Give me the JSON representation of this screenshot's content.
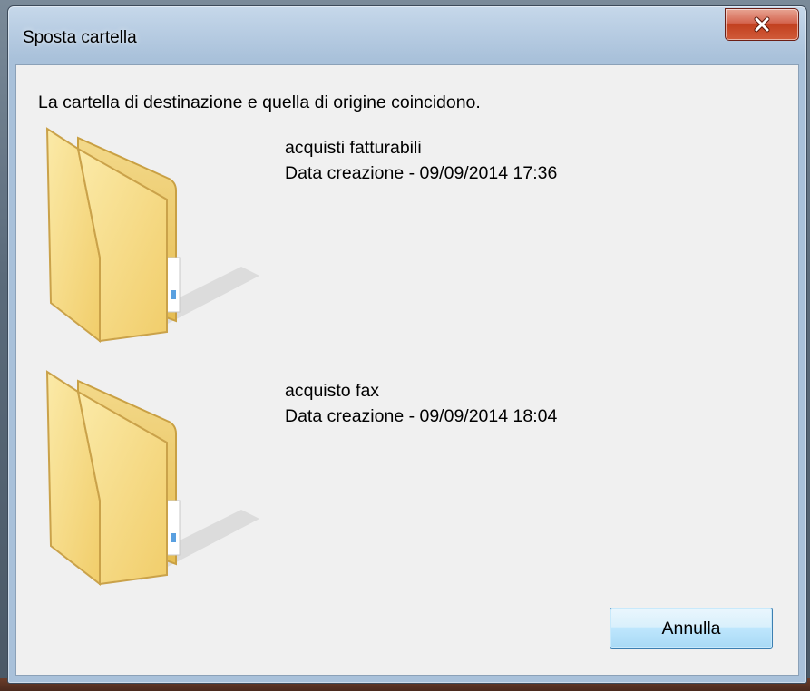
{
  "window": {
    "title": "Sposta cartella",
    "close_icon": "close-icon"
  },
  "message": "La cartella di destinazione e quella di origine coincidono.",
  "items": [
    {
      "name": "acquisti fatturabili",
      "date": "Data creazione - 09/09/2014 17:36",
      "icon": "folder-icon"
    },
    {
      "name": "acquisto fax",
      "date": "Data creazione - 09/09/2014 18:04",
      "icon": "folder-icon"
    }
  ],
  "buttons": {
    "cancel": "Annulla"
  },
  "colors": {
    "close_button": "#c2401f",
    "folder_body": "#f6dc86",
    "folder_back": "#e9c45c",
    "dialog_bg": "#f0f0f0",
    "button_border": "#3c7fb1"
  }
}
